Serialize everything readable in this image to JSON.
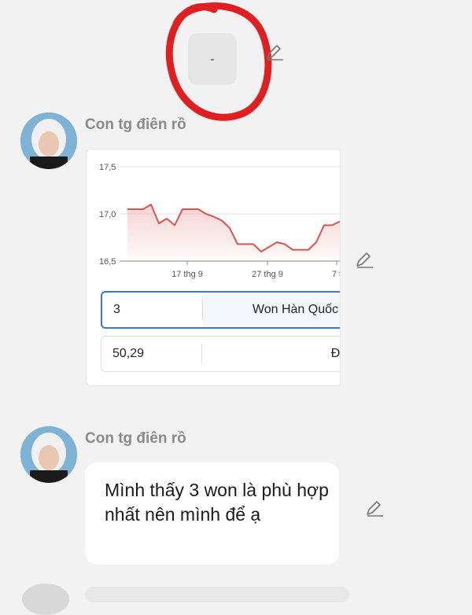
{
  "top_bubble": {
    "text": "-"
  },
  "messages": [
    {
      "sender": "Con tg điên rồ"
    },
    {
      "sender": "Con tg điên rồ",
      "text": "Mình thấy 3 won là phù hợp nhất nên mình để ạ"
    }
  ],
  "converter": {
    "from": {
      "amount": "3",
      "unit": "Won Hàn Quốc"
    },
    "to": {
      "amount": "50,29",
      "unit": "Đồng"
    }
  },
  "chart_data": {
    "type": "area",
    "color": "#d9534f",
    "ylim": [
      16.5,
      17.5
    ],
    "yticks": [
      "17,5",
      "17,0",
      "16,5"
    ],
    "xticks": [
      "17 thg 9",
      "27 thg 9",
      "7 t"
    ],
    "values": [
      17.05,
      17.05,
      17.05,
      17.1,
      16.9,
      16.95,
      16.88,
      17.05,
      17.05,
      17.05,
      17.0,
      16.97,
      16.93,
      16.85,
      16.68,
      16.68,
      16.68,
      16.6,
      16.65,
      16.7,
      16.68,
      16.62,
      16.62,
      16.62,
      16.7,
      16.88,
      16.88,
      16.92
    ]
  },
  "colors": {
    "annotation": "#e02020",
    "accent": "#3b78c0"
  }
}
